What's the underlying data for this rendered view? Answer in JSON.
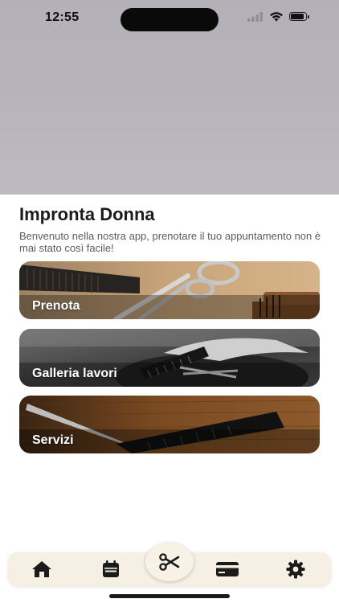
{
  "status_bar": {
    "time": "12:55",
    "battery_level": 0.9,
    "icons": [
      "signal-icon",
      "wifi-icon",
      "battery-icon"
    ]
  },
  "header": {
    "title": "Impronta Donna",
    "welcome_text": "Benvenuto nella nostra app, prenotare il tuo appuntamento non è mai stato così facile!"
  },
  "cards": [
    {
      "label": "Prenota",
      "image": "hair-tools-photo"
    },
    {
      "label": "Galleria lavori",
      "image": "haircut-photo"
    },
    {
      "label": "Servizi",
      "image": "wood-scissors-photo"
    }
  ],
  "tab_bar": {
    "items": [
      {
        "icon": "home-icon",
        "active": true
      },
      {
        "icon": "calendar-icon",
        "active": false
      },
      {
        "icon": "scissors-icon",
        "active": false,
        "center": true
      },
      {
        "icon": "credit-card-icon",
        "active": false
      },
      {
        "icon": "gear-icon",
        "active": false
      }
    ]
  },
  "colors": {
    "hero_background": "#b5b3b9",
    "tab_bar_background": "#f6f0e4",
    "icon_color": "#1b1b1b",
    "title_color": "#1b1b1b",
    "subtitle_color": "#5c5c5c"
  }
}
